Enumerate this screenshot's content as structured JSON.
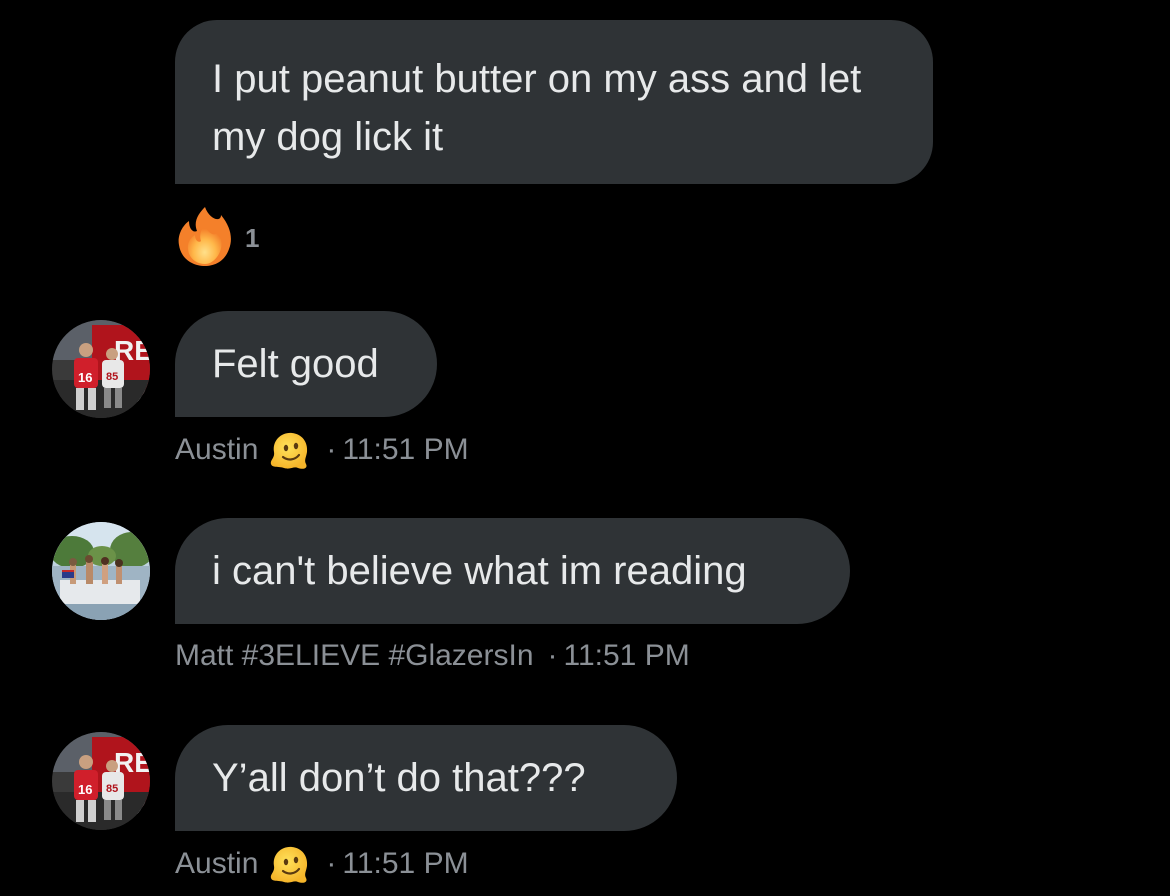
{
  "messages": [
    {
      "text": "I put peanut butter on my ass and let my dog lick it",
      "reactions": [
        {
          "icon": "fire-icon",
          "count": "1"
        }
      ]
    },
    {
      "text": "Felt good",
      "sender": "Austin",
      "sender_emoji": "melting-face-icon",
      "separator": "·",
      "time": "11:51 PM"
    },
    {
      "text": "i can't believe what im reading",
      "sender": "Matt #3ELIEVE #GlazersIn",
      "separator": "·",
      "time": "11:51 PM"
    },
    {
      "text": "Y’all don’t do that???",
      "sender": "Austin",
      "sender_emoji": "melting-face-icon",
      "separator": "·",
      "time": "11:51 PM"
    }
  ],
  "colors": {
    "background": "#000000",
    "bubble": "#2f3336",
    "text": "#e7e9ea",
    "meta": "#8b9096"
  }
}
